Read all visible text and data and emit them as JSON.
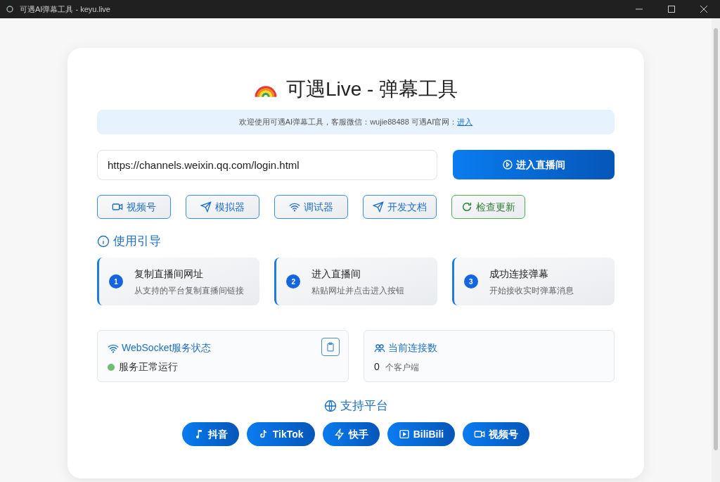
{
  "window": {
    "title": "可遇AI弹幕工具 - keyu.live"
  },
  "heading": "可遇Live - 弹幕工具",
  "notice": {
    "text": "欢迎使用可遇AI弹幕工具，客服微信：wujie88488 可遇AI官网：",
    "link": "进入"
  },
  "url_field": {
    "value": "https://channels.weixin.qq.com/login.html"
  },
  "enter_button": "进入直播间",
  "tools": [
    {
      "label": "视频号",
      "kind": "default"
    },
    {
      "label": "模拟器",
      "kind": "default"
    },
    {
      "label": "调试器",
      "kind": "default"
    },
    {
      "label": "开发文档",
      "kind": "default"
    },
    {
      "label": "检查更新",
      "kind": "success"
    }
  ],
  "guide": {
    "title": "使用引导",
    "steps": [
      {
        "number": "1",
        "title": "复制直播间网址",
        "text": "从支持的平台复制直播间链接"
      },
      {
        "number": "2",
        "title": "进入直播间",
        "text": "粘贴网址并点击进入按钮"
      },
      {
        "number": "3",
        "title": "成功连接弹幕",
        "text": "开始接收实时弹幕消息"
      }
    ]
  },
  "websocket": {
    "title": "WebSocket服务状态",
    "online": true,
    "status": "服务正常运行"
  },
  "connections": {
    "title": "当前连接数",
    "count": "0",
    "unit": "个客户端"
  },
  "platforms": {
    "title": "支持平台",
    "items": [
      "抖音",
      "TikTok",
      "快手",
      "BiliBili",
      "视频号"
    ]
  }
}
